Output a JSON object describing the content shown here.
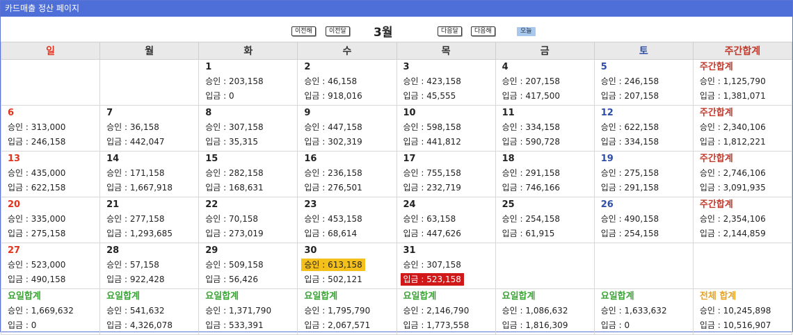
{
  "window": {
    "title": "카드매출 정산 페이지"
  },
  "nav": {
    "prev_year": "이전해",
    "prev_month": "이전달",
    "month": "3월",
    "next_month": "다음달",
    "next_year": "다음해",
    "today": "오늘"
  },
  "headers": [
    "일",
    "월",
    "화",
    "수",
    "목",
    "금",
    "토",
    "주간합계"
  ],
  "weeks": [
    {
      "days": [
        {
          "date": "",
          "approve": "",
          "deposit": ""
        },
        {
          "date": "",
          "approve": "",
          "deposit": ""
        },
        {
          "date": "1",
          "approve": "승인 : 203,158",
          "deposit": "입금 : 0"
        },
        {
          "date": "2",
          "approve": "승인 : 46,158",
          "deposit": "입금 : 918,016"
        },
        {
          "date": "3",
          "approve": "승인 : 423,158",
          "deposit": "입금 : 45,555"
        },
        {
          "date": "4",
          "approve": "승인 : 207,158",
          "deposit": "입금 : 417,500"
        },
        {
          "date": "5",
          "approve": "승인 : 246,158",
          "deposit": "입금 : 207,158"
        }
      ],
      "total": {
        "label": "주간합계",
        "approve": "승인 : 1,125,790",
        "deposit": "입금 : 1,381,071"
      }
    },
    {
      "days": [
        {
          "date": "6",
          "approve": "승인 : 313,000",
          "deposit": "입금 : 246,158"
        },
        {
          "date": "7",
          "approve": "승인 : 36,158",
          "deposit": "입금 : 442,047"
        },
        {
          "date": "8",
          "approve": "승인 : 307,158",
          "deposit": "입금 : 35,315"
        },
        {
          "date": "9",
          "approve": "승인 : 447,158",
          "deposit": "입금 : 302,319"
        },
        {
          "date": "10",
          "approve": "승인 : 598,158",
          "deposit": "입금 : 441,812"
        },
        {
          "date": "11",
          "approve": "승인 : 334,158",
          "deposit": "입금 : 590,728"
        },
        {
          "date": "12",
          "approve": "승인 : 622,158",
          "deposit": "입금 : 334,158"
        }
      ],
      "total": {
        "label": "주간합계",
        "approve": "승인 : 2,340,106",
        "deposit": "입금 : 1,812,221"
      }
    },
    {
      "days": [
        {
          "date": "13",
          "approve": "승인 : 435,000",
          "deposit": "입금 : 622,158"
        },
        {
          "date": "14",
          "approve": "승인 : 171,158",
          "deposit": "입금 : 1,667,918"
        },
        {
          "date": "15",
          "approve": "승인 : 282,158",
          "deposit": "입금 : 168,631"
        },
        {
          "date": "16",
          "approve": "승인 : 236,158",
          "deposit": "입금 : 276,501"
        },
        {
          "date": "17",
          "approve": "승인 : 755,158",
          "deposit": "입금 : 232,719"
        },
        {
          "date": "18",
          "approve": "승인 : 291,158",
          "deposit": "입금 : 746,166"
        },
        {
          "date": "19",
          "approve": "승인 : 275,158",
          "deposit": "입금 : 291,158"
        }
      ],
      "total": {
        "label": "주간합계",
        "approve": "승인 : 2,746,106",
        "deposit": "입금 : 3,091,935"
      }
    },
    {
      "days": [
        {
          "date": "20",
          "approve": "승인 : 335,000",
          "deposit": "입금 : 275,158"
        },
        {
          "date": "21",
          "approve": "승인 : 277,158",
          "deposit": "입금 : 1,293,685"
        },
        {
          "date": "22",
          "approve": "승인 : 70,158",
          "deposit": "입금 : 273,019"
        },
        {
          "date": "23",
          "approve": "승인 : 453,158",
          "deposit": "입금 : 68,614"
        },
        {
          "date": "24",
          "approve": "승인 : 63,158",
          "deposit": "입금 : 447,626"
        },
        {
          "date": "25",
          "approve": "승인 : 254,158",
          "deposit": "입금 : 61,915"
        },
        {
          "date": "26",
          "approve": "승인 : 490,158",
          "deposit": "입금 : 254,158"
        }
      ],
      "total": {
        "label": "주간합계",
        "approve": "승인 : 2,354,106",
        "deposit": "입금 : 2,144,859"
      }
    },
    {
      "days": [
        {
          "date": "27",
          "approve": "승인 : 523,000",
          "deposit": "입금 : 490,158"
        },
        {
          "date": "28",
          "approve": "승인 : 57,158",
          "deposit": "입금 : 922,428"
        },
        {
          "date": "29",
          "approve": "승인 : 509,158",
          "deposit": "입금 : 56,426"
        },
        {
          "date": "30",
          "approve": "승인 : 613,158",
          "deposit": "입금 : 502,121"
        },
        {
          "date": "31",
          "approve": "승인 : 307,158",
          "deposit": "입금 : 523,158"
        },
        {
          "date": "",
          "approve": "",
          "deposit": ""
        },
        {
          "date": "",
          "approve": "",
          "deposit": ""
        }
      ],
      "total": {
        "label": "",
        "approve": "",
        "deposit": ""
      }
    }
  ],
  "dow_totals": [
    {
      "label": "요일합계",
      "approve": "승인 : 1,669,632",
      "deposit": "입금 : 0"
    },
    {
      "label": "요일합계",
      "approve": "승인 : 541,632",
      "deposit": "입금 : 4,326,078"
    },
    {
      "label": "요일합계",
      "approve": "승인 : 1,371,790",
      "deposit": "입금 : 533,391"
    },
    {
      "label": "요일합계",
      "approve": "승인 : 1,795,790",
      "deposit": "입금 : 2,067,571"
    },
    {
      "label": "요일합계",
      "approve": "승인 : 2,146,790",
      "deposit": "입금 : 1,773,558"
    },
    {
      "label": "요일합계",
      "approve": "승인 : 1,086,632",
      "deposit": "입금 : 1,816,309"
    },
    {
      "label": "요일합계",
      "approve": "승인 : 1,633,632",
      "deposit": "입금 : 0"
    }
  ],
  "grand_total": {
    "label": "전체 합계",
    "approve": "승인 : 10,245,898",
    "deposit": "입금 : 10,516,907"
  },
  "highlights": {
    "approve_highlight": "#f4c01c",
    "deposit_highlight": "#d01818"
  },
  "colors": {
    "titlebar": "#4f6fd8",
    "sunday": "#e2331c",
    "saturday": "#2e4ea8",
    "weekly_total": "#c0392b",
    "dow_total": "#3aa435",
    "grand_total": "#e8a21c"
  }
}
